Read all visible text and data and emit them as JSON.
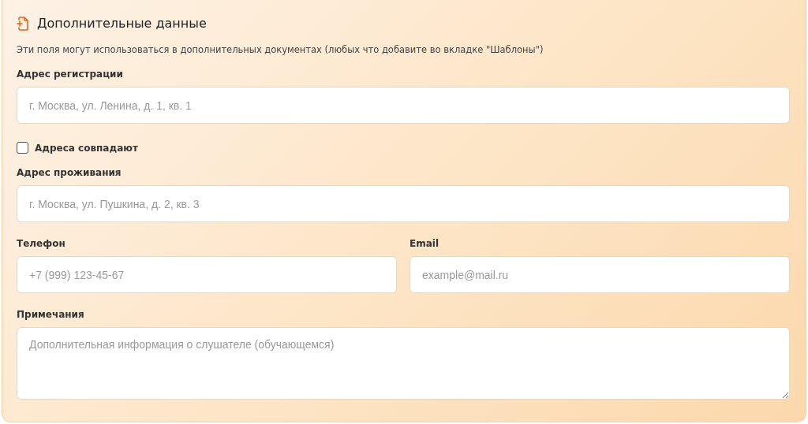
{
  "card": {
    "title": "Дополнительные данные",
    "description": "Эти поля могут использоваться в дополнительных документах (любых что добавите во вкладке \"Шаблоны\")",
    "rows": [
      {
        "items": [
          {
            "kind": "text",
            "label": "Адрес регистрации",
            "placeholder": "г. Москва, ул. Ленина, д. 1, кв. 1"
          }
        ]
      },
      {
        "items": [
          {
            "kind": "checkbox",
            "label": "Адреса совпадают",
            "checked": false
          }
        ]
      },
      {
        "items": [
          {
            "kind": "text",
            "label": "Адрес проживания",
            "placeholder": "г. Москва, ул. Пушкина, д. 2, кв. 3"
          }
        ]
      },
      {
        "items": [
          {
            "kind": "text",
            "label": "Телефон",
            "placeholder": "+7 (999) 123-45-67"
          },
          {
            "kind": "text",
            "label": "Email",
            "placeholder": "example@mail.ru"
          }
        ]
      },
      {
        "items": [
          {
            "kind": "textarea",
            "label": "Примечания",
            "placeholder": "Дополнительная информация о слушателе (обучающемся)"
          }
        ]
      }
    ]
  }
}
